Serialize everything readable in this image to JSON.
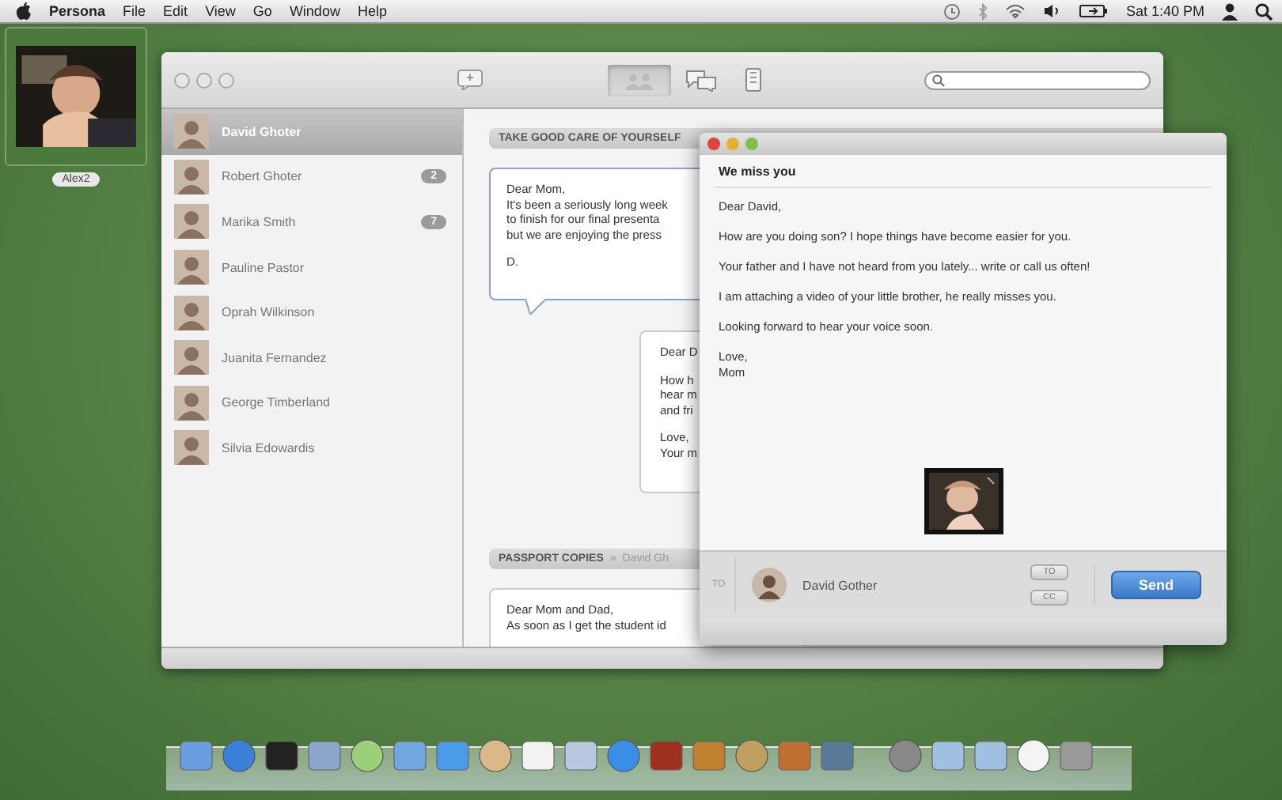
{
  "menu_bar": {
    "app": "Persona",
    "menus": [
      "File",
      "Edit",
      "View",
      "Go",
      "Window",
      "Help"
    ],
    "clock": "Sat 1:40 PM"
  },
  "desktop_widget": {
    "label": "Alex2",
    "kind": "picture"
  },
  "main_window": {
    "toolbar": [
      {
        "kind": "compose",
        "selected": false
      },
      {
        "kind": "contacts",
        "selected": true
      },
      {
        "kind": "chat",
        "selected": false
      },
      {
        "kind": "phone",
        "selected": false
      }
    ],
    "contacts": [
      {
        "name": "David Ghoter",
        "selected": true
      },
      {
        "name": "Robert Ghoter",
        "selected": false,
        "badge": "2"
      },
      {
        "name": "Marika Smith",
        "selected": false,
        "badge": "7"
      },
      {
        "name": "Pauline Pastor",
        "selected": false
      },
      {
        "name": "Oprah Wilkinson",
        "selected": false
      },
      {
        "name": "Juanita Fernandez",
        "selected": false
      },
      {
        "name": "George Timberland",
        "selected": false
      },
      {
        "name": "Silvia Edowardis",
        "selected": false
      }
    ],
    "threads": [
      {
        "subject": "TAKE GOOD CARE OF YOURSELF",
        "messages": [
          {
            "kind": "sent",
            "paragraphs": [
              [
                "Dear Mom,",
                "It's been a seriously long week",
                "to finish for our final presenta",
                "but we are enjoying the press"
              ],
              [
                "D."
              ]
            ]
          },
          {
            "kind": "received",
            "paragraphs": [
              [
                "Dear D"
              ],
              [
                "How h",
                "hear m",
                "and fri"
              ],
              [
                "Love,",
                "Your m"
              ]
            ]
          }
        ]
      },
      {
        "subject": "PASSPORT COPIES",
        "separator": "»",
        "recipient": "David Gh",
        "messages": [
          {
            "kind": "sent",
            "paragraphs": [
              [
                "Dear Mom and Dad,",
                "As soon as I get the student id"
              ]
            ]
          }
        ]
      }
    ]
  },
  "compose": {
    "subject": "We miss you",
    "paragraphs": [
      [
        "Dear David,"
      ],
      [
        "How are you doing son? I hope things have become easier for you."
      ],
      [
        "Your father and I have not heard from you lately... write or call us often!"
      ],
      [
        "I am attaching a video of your little brother, he really misses you."
      ],
      [
        "Looking forward to hear your voice soon."
      ],
      [
        "Love,",
        "Mom"
      ]
    ],
    "attachment": {
      "kind": "picture"
    },
    "to_label": "TO",
    "recipient": "David Gother",
    "buttons": [
      "TO",
      "CC"
    ],
    "send": "Send"
  }
}
